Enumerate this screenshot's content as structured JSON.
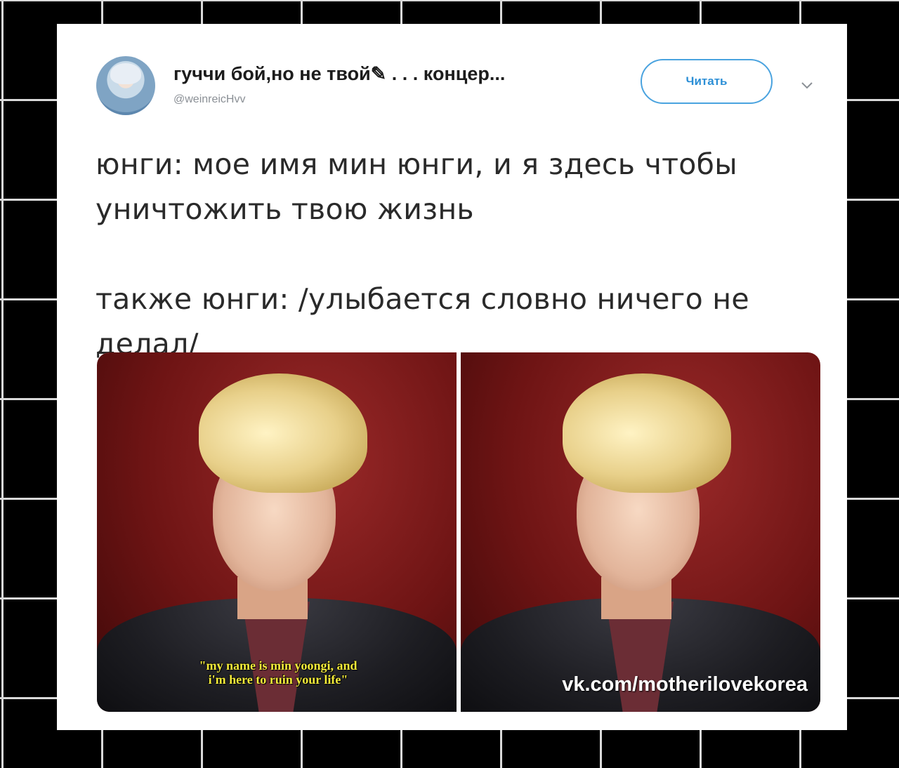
{
  "tweet": {
    "display_name": "гуччи бой,но не твой✎ . . . концер...",
    "handle": "@weinreicHvv",
    "follow_label": "Читать",
    "text_lines": [
      "юнги: мое имя мин юнги, и я здесь чтобы",
      "уничтожить твою жизнь",
      "также юнги: /улыбается словно ничего не",
      "делал/"
    ]
  },
  "media": {
    "left_caption_line1": "\"my name is min yoongi, and",
    "left_caption_line2": "i'm here to ruin your life\"",
    "right_watermark": "vk.com/motherilovekorea"
  },
  "icons": {
    "avatar": "user-avatar",
    "more": "chevron-down-icon"
  },
  "colors": {
    "accent": "#4aa3df",
    "background": "#000000",
    "grid": "#d9d9d9"
  }
}
